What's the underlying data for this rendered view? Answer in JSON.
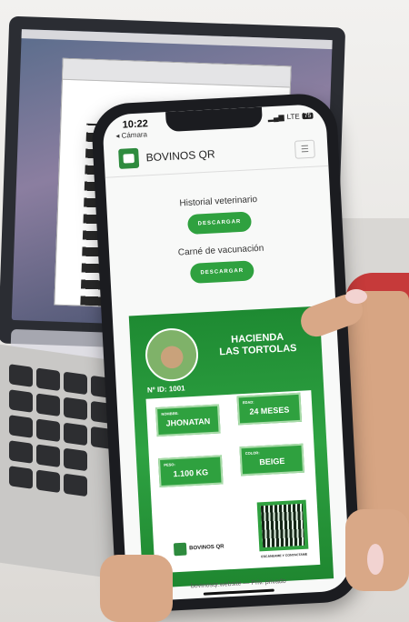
{
  "phone": {
    "time": "10:22",
    "back_label": "◂ Cámara",
    "network": "LTE",
    "battery": "75"
  },
  "app": {
    "title": "BOVINOS QR",
    "menu_icon": "hamburger-icon"
  },
  "sections": {
    "vet_history": "Historial veterinario",
    "vet_download": "DESCARGAR",
    "vaccine_card": "Carné de vacunación",
    "vaccine_download": "DESCARGAR"
  },
  "card": {
    "hacienda_line1": "HACIENDA",
    "hacienda_line2": "LAS TORTOLAS",
    "id": "Nº ID: 1001",
    "fields": {
      "nombre_label": "NOMBRE:",
      "nombre_value": "JHONATAN",
      "edad_label": "EDAD:",
      "edad_value": "24 MESES",
      "peso_label": "PESO:",
      "peso_value": "1.100 KG",
      "color_label": "COLOR:",
      "color_value": "BEIGE"
    },
    "brand": "BOVINOS QR",
    "qr_caption": "ESCANEAME Y CONTACTAME"
  },
  "browser": {
    "url": "bovinosqr.website — Priv. privado"
  },
  "colors": {
    "brand_green": "#2fa13f",
    "card_green": "#1e8a32"
  }
}
